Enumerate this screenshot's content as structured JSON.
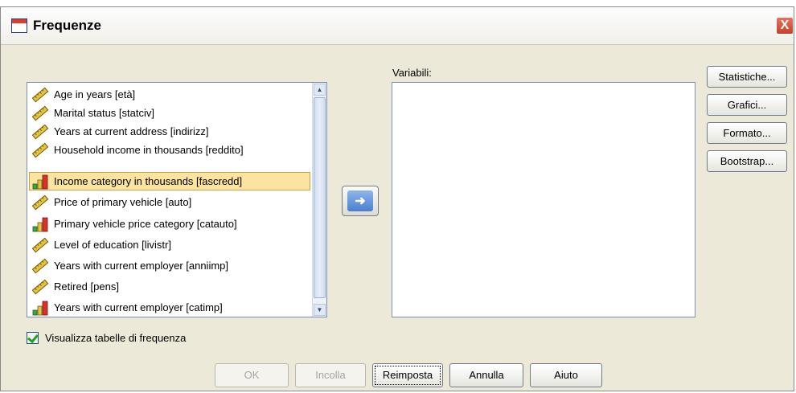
{
  "window": {
    "title": "Frequenze",
    "close_label": "X"
  },
  "source_list": {
    "items": [
      {
        "label": "Age in years [età]",
        "type": "scale",
        "selected": false
      },
      {
        "label": "Marital status [statciv]",
        "type": "scale",
        "selected": false
      },
      {
        "label": "Years at current address [indirizz]",
        "type": "scale",
        "selected": false
      },
      {
        "label": "Household income in thousands [reddito]",
        "type": "scale",
        "selected": false
      },
      {
        "label": "Income category in thousands [fascredd]",
        "type": "ordinal",
        "selected": true
      },
      {
        "label": "Price of primary vehicle [auto]",
        "type": "scale",
        "selected": false
      },
      {
        "label": "Primary vehicle price category [catauto]",
        "type": "ordinal",
        "selected": false
      },
      {
        "label": "Level of education [livistr]",
        "type": "scale",
        "selected": false
      },
      {
        "label": "Years with current employer [anniimp]",
        "type": "scale",
        "selected": false
      },
      {
        "label": "Retired [pens]",
        "type": "scale",
        "selected": false
      },
      {
        "label": "Years with current employer [catimp]",
        "type": "ordinal",
        "selected": false
      }
    ]
  },
  "variables": {
    "label": "Variabili:",
    "items": []
  },
  "move_button": {
    "icon": "arrow-right-icon",
    "glyph": "➜"
  },
  "side_buttons": [
    {
      "label": "Statistiche..."
    },
    {
      "label": "Grafici..."
    },
    {
      "label": "Formato..."
    },
    {
      "label": "Bootstrap..."
    }
  ],
  "display_tables": {
    "label": "Visualizza tabelle di frequenza",
    "checked": true
  },
  "bottom_buttons": [
    {
      "label": "OK",
      "enabled": false
    },
    {
      "label": "Incolla",
      "enabled": false
    },
    {
      "label": "Reimposta",
      "enabled": true
    },
    {
      "label": "Annulla",
      "enabled": true
    },
    {
      "label": "Aiuto",
      "enabled": true
    }
  ],
  "colors": {
    "dialog_bg": "#ece9d8",
    "selection_bg": "#fbe3a0",
    "ruler_yellow": "#e8c33a",
    "ordinal_red": "#d8322b",
    "ordinal_green": "#3aa541"
  }
}
